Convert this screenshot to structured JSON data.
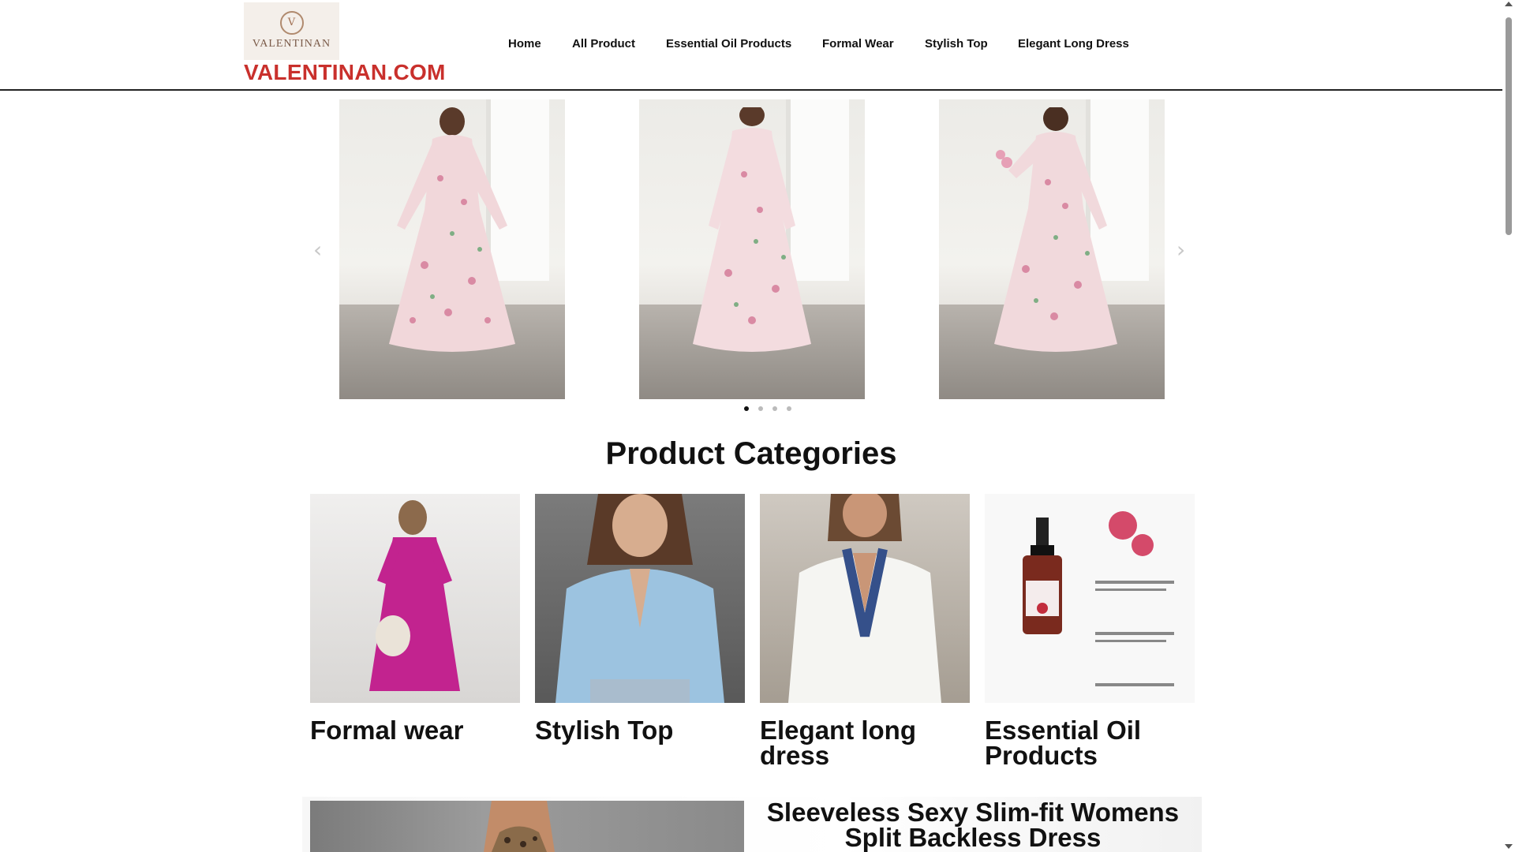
{
  "header": {
    "logo": {
      "word": "VALENTINAN",
      "monogram": "V"
    },
    "site_name": "VALENTINAN.COM",
    "nav": [
      {
        "label": "Home"
      },
      {
        "label": "All Product"
      },
      {
        "label": "Essential Oil Products"
      },
      {
        "label": "Formal Wear"
      },
      {
        "label": "Stylish Top"
      },
      {
        "label": "Elegant Long Dress"
      }
    ]
  },
  "carousel": {
    "slides": 3,
    "prev_icon": "chevron-left-icon",
    "next_icon": "chevron-right-icon",
    "pagination": {
      "total": 4,
      "active": 1
    }
  },
  "categories": {
    "title": "Product Categories",
    "items": [
      {
        "name": "Formal wear",
        "color": "#c2238f"
      },
      {
        "name": "Stylish Top",
        "color": "#9cc3e0"
      },
      {
        "name": "Elegant long dress",
        "color": "#f5f5f2"
      },
      {
        "name": "Essential Oil Products",
        "color": "#7a2a1e"
      }
    ]
  },
  "feature": {
    "title": "Sleeveless Sexy Slim-fit Womens Split Backless Dress"
  },
  "colors": {
    "brand": "#c9302c",
    "text": "#111111"
  }
}
